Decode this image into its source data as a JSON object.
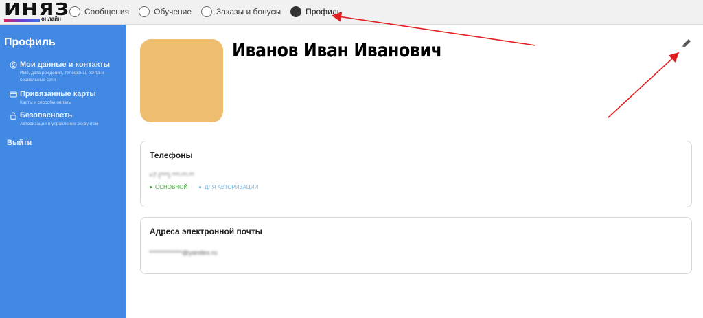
{
  "header": {
    "logo_text": "ИНЯЗ",
    "logo_sub": "онлайн",
    "nav": [
      {
        "label": "Сообщения",
        "active": false,
        "icon": "radio-empty-icon"
      },
      {
        "label": "Обучение",
        "active": false,
        "icon": "radio-empty-icon"
      },
      {
        "label": "Заказы и бонусы",
        "active": false,
        "icon": "radio-empty-icon"
      },
      {
        "label": "Профиль",
        "active": true,
        "icon": "radio-filled-icon"
      }
    ]
  },
  "sidebar": {
    "title": "Профиль",
    "items": [
      {
        "label": "Мои данные и контакты",
        "sub": "Имя, дата рождения, телефоны, почта и социальные сети",
        "icon": "user-circle-icon"
      },
      {
        "label": "Привязанные карты",
        "sub": "Карты и способы оплаты",
        "icon": "credit-card-icon"
      },
      {
        "label": "Безопасность",
        "sub": "Авторизация и управление аккаунтом",
        "icon": "lock-icon"
      }
    ],
    "logout": "Выйти"
  },
  "profile": {
    "name": "Иванов Иван Иванович",
    "edit_icon": "pencil-icon"
  },
  "phones": {
    "title": "Телефоны",
    "value": "+7 (***) ***-**-**",
    "tag_main": "ОСНОВНОЙ",
    "tag_auth": "ДЛЯ АВТОРИЗАЦИИ"
  },
  "emails": {
    "title": "Адреса электронной почты",
    "value": "*************@yandex.ru"
  },
  "colors": {
    "sidebar": "#4189e3",
    "avatar": "#eebd6f",
    "tag_main": "#47a23f",
    "tag_auth": "#7bb6e2",
    "annotation_arrow": "#e02020"
  }
}
